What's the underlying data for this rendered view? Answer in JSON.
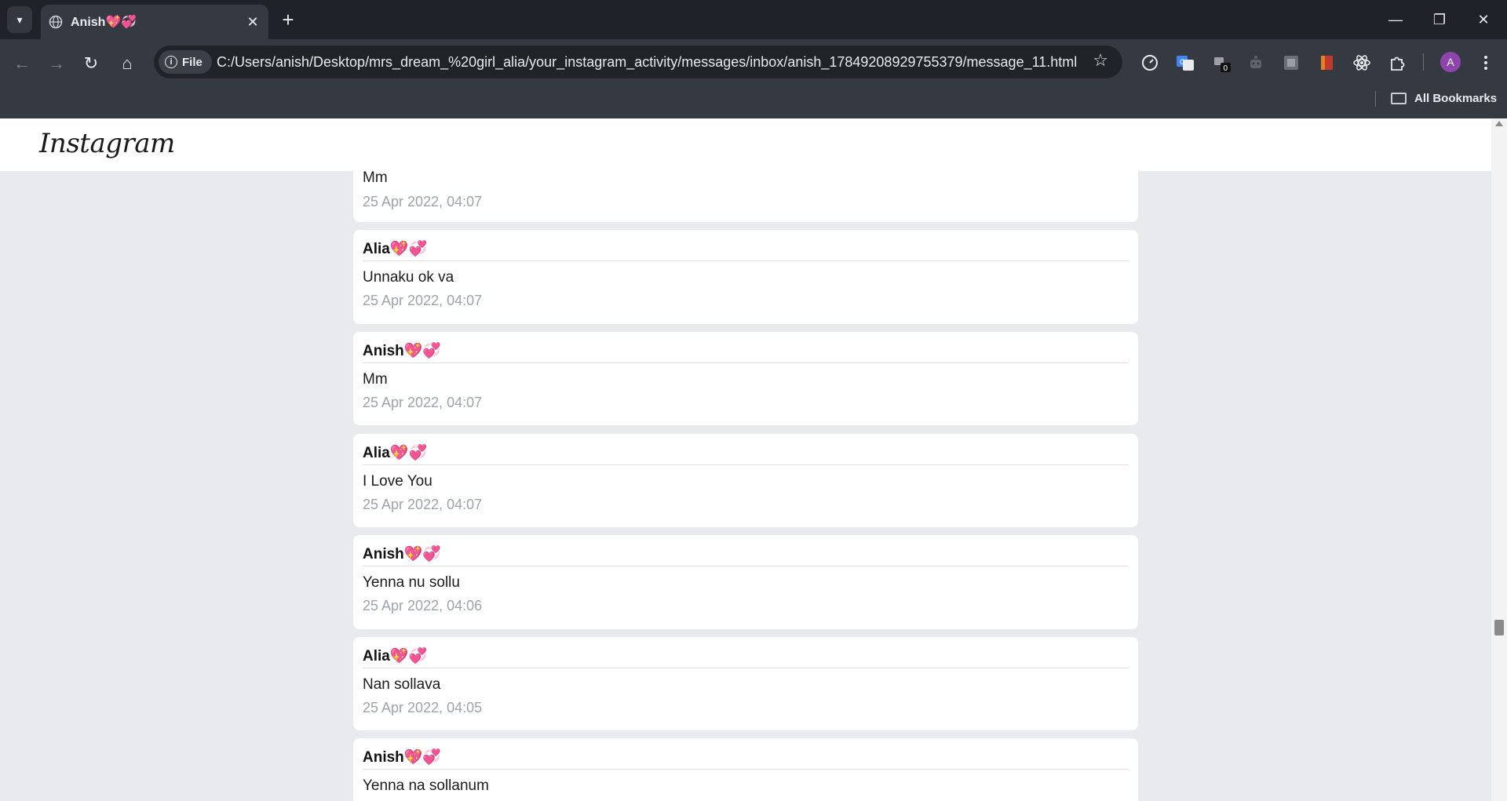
{
  "browser": {
    "tab_title": "Anish💖💞",
    "address_chip": "File",
    "url": "C:/Users/anish/Desktop/mrs_dream_%20girl_alia/your_instagram_activity/messages/inbox/anish_17849208929755379/message_11.html",
    "extension_badge": "0",
    "profile_initial": "A",
    "bookmarks_label": "All Bookmarks",
    "icons": {
      "tab_menu": "▾",
      "close": "✕",
      "new_tab": "+",
      "minimize": "—",
      "restore": "❐",
      "window_close": "✕",
      "back": "←",
      "forward": "→",
      "reload": "↻",
      "home": "⌂",
      "info": "i",
      "star": "☆"
    }
  },
  "page": {
    "logo": "Instagram",
    "messages": [
      {
        "sender": "",
        "text": "Mm",
        "time": "25 Apr 2022, 04:07"
      },
      {
        "sender": "Alia💖💞",
        "text": "Unnaku ok va",
        "time": "25 Apr 2022, 04:07"
      },
      {
        "sender": "Anish💖💞",
        "text": "Mm",
        "time": "25 Apr 2022, 04:07"
      },
      {
        "sender": "Alia💖💞",
        "text": "I Love You",
        "time": "25 Apr 2022, 04:07"
      },
      {
        "sender": "Anish💖💞",
        "text": "Yenna nu sollu",
        "time": "25 Apr 2022, 04:06"
      },
      {
        "sender": "Alia💖💞",
        "text": "Nan sollava",
        "time": "25 Apr 2022, 04:05"
      },
      {
        "sender": "Anish💖💞",
        "text": "Yenna na sollanum",
        "time": ""
      }
    ]
  }
}
